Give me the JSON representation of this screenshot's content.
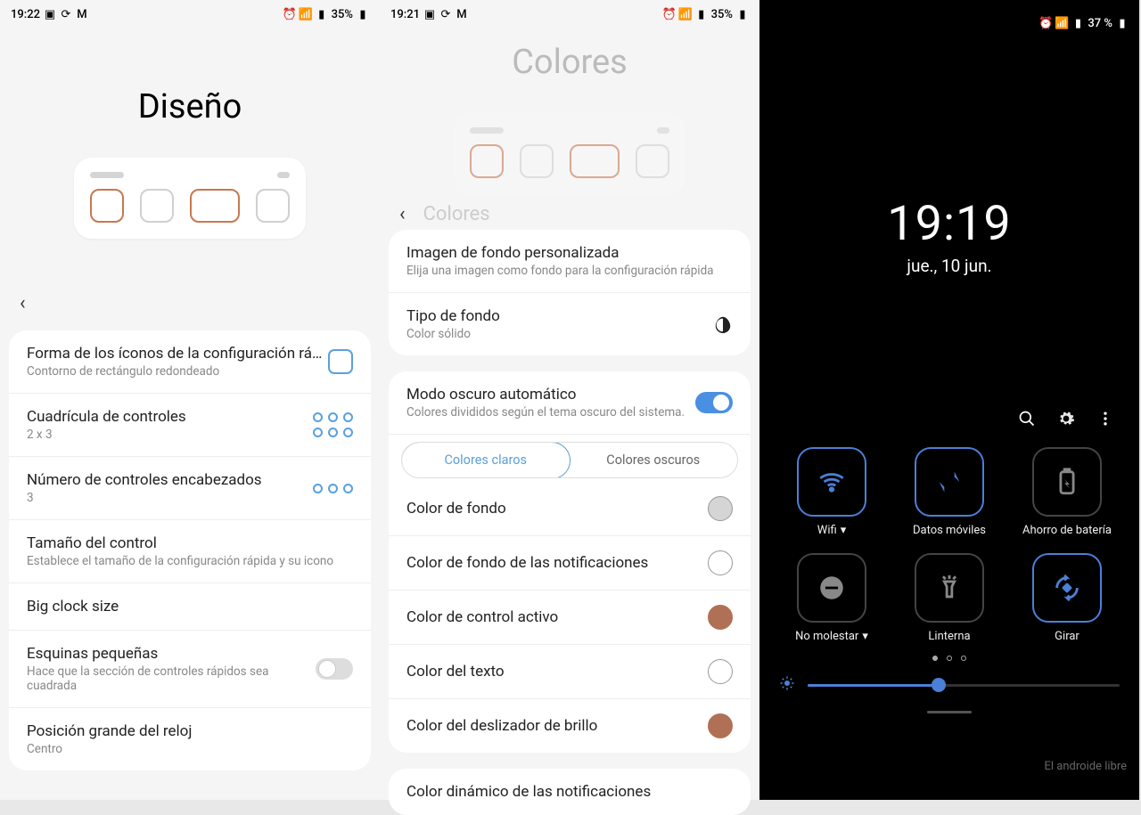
{
  "p1": {
    "status": {
      "time": "19:22",
      "battery": "35%"
    },
    "title": "Diseño",
    "rows": [
      {
        "t": "Forma de los íconos de la configuración ráp..",
        "s": "Contorno de rectángulo redondeado"
      },
      {
        "t": "Cuadrícula de controles",
        "s": "2 x 3"
      },
      {
        "t": "Número de controles encabezados",
        "s": "3"
      },
      {
        "t": "Tamaño del control",
        "s": "Establece el tamaño de la configuración rápida y su icono"
      },
      {
        "t": "Big clock size",
        "s": ""
      },
      {
        "t": "Esquinas pequeñas",
        "s": "Hace que la sección de controles rápidos sea cuadrada"
      },
      {
        "t": "Posición grande del reloj",
        "s": "Centro"
      }
    ]
  },
  "p2": {
    "status": {
      "time": "19:21",
      "battery": "35%"
    },
    "title": "Colores",
    "subtitle": "Colores",
    "rows1": [
      {
        "t": "Imagen de fondo personalizada",
        "s": "Elija una imagen como fondo para la configuración rápida"
      },
      {
        "t": "Tipo de fondo",
        "s": "Color sólido"
      }
    ],
    "auto": {
      "t": "Modo oscuro automático",
      "s": "Colores divididos según el tema oscuro del sistema."
    },
    "seg": {
      "a": "Colores claros",
      "b": "Colores oscuros"
    },
    "colors": [
      {
        "t": "Color de fondo",
        "c": "grey"
      },
      {
        "t": "Color de fondo de las notificaciones",
        "c": "white"
      },
      {
        "t": "Color de control activo",
        "c": "brown"
      },
      {
        "t": "Color del texto",
        "c": "white"
      },
      {
        "t": "Color del deslizador de brillo",
        "c": "brown"
      }
    ],
    "last": {
      "t": "Color dinámico de las notificaciones"
    }
  },
  "p3": {
    "status": {
      "battery": "37 %"
    },
    "clock": {
      "time": "19:19",
      "date": "jue., 10 jun."
    },
    "tiles": [
      {
        "label": "Wifi",
        "drop": true,
        "active": true,
        "icon": "wifi"
      },
      {
        "label": "Datos móviles",
        "drop": false,
        "active": true,
        "icon": "data"
      },
      {
        "label": "Ahorro de batería",
        "drop": false,
        "active": false,
        "icon": "battery"
      },
      {
        "label": "No molestar",
        "drop": true,
        "active": false,
        "icon": "dnd"
      },
      {
        "label": "Linterna",
        "drop": false,
        "active": false,
        "icon": "flash"
      },
      {
        "label": "Girar",
        "drop": false,
        "active": true,
        "icon": "rotate"
      }
    ],
    "watermark": "El androide libre"
  }
}
